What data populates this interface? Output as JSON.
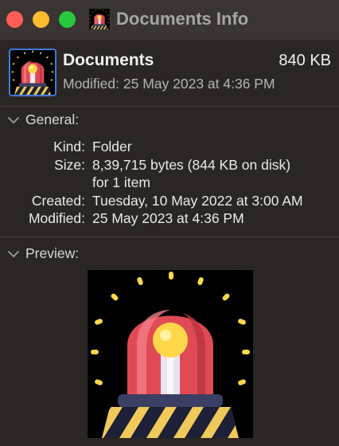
{
  "window": {
    "title": "Documents Info",
    "controls": [
      "close",
      "minimize",
      "zoom"
    ]
  },
  "header": {
    "icon": "alarm-siren-icon",
    "name": "Documents",
    "size": "840 KB",
    "modified": "Modified: 25 May 2023 at 4:36 PM"
  },
  "general": {
    "label": "General:",
    "rows": [
      {
        "key": "Kind:",
        "value": "Folder"
      },
      {
        "key": "Size:",
        "value": "8,39,715 bytes (844 KB on disk)",
        "value2": "for 1 item"
      },
      {
        "key": "Created:",
        "value": "Tuesday, 10 May 2022 at 3:00 AM"
      },
      {
        "key": "Modified:",
        "value": "25 May 2023 at 4:36 PM"
      }
    ]
  },
  "preview": {
    "label": "Preview:",
    "image": "alarm-siren-icon"
  },
  "colors": {
    "background": "#2b2624",
    "titlebar": "#3a3532",
    "close": "#ff5f57",
    "minimize": "#febc2e",
    "zoom": "#28c840",
    "selection_border": "#3f7ad9",
    "siren_red": "#e04a55",
    "siren_light": "#ffd84a"
  }
}
